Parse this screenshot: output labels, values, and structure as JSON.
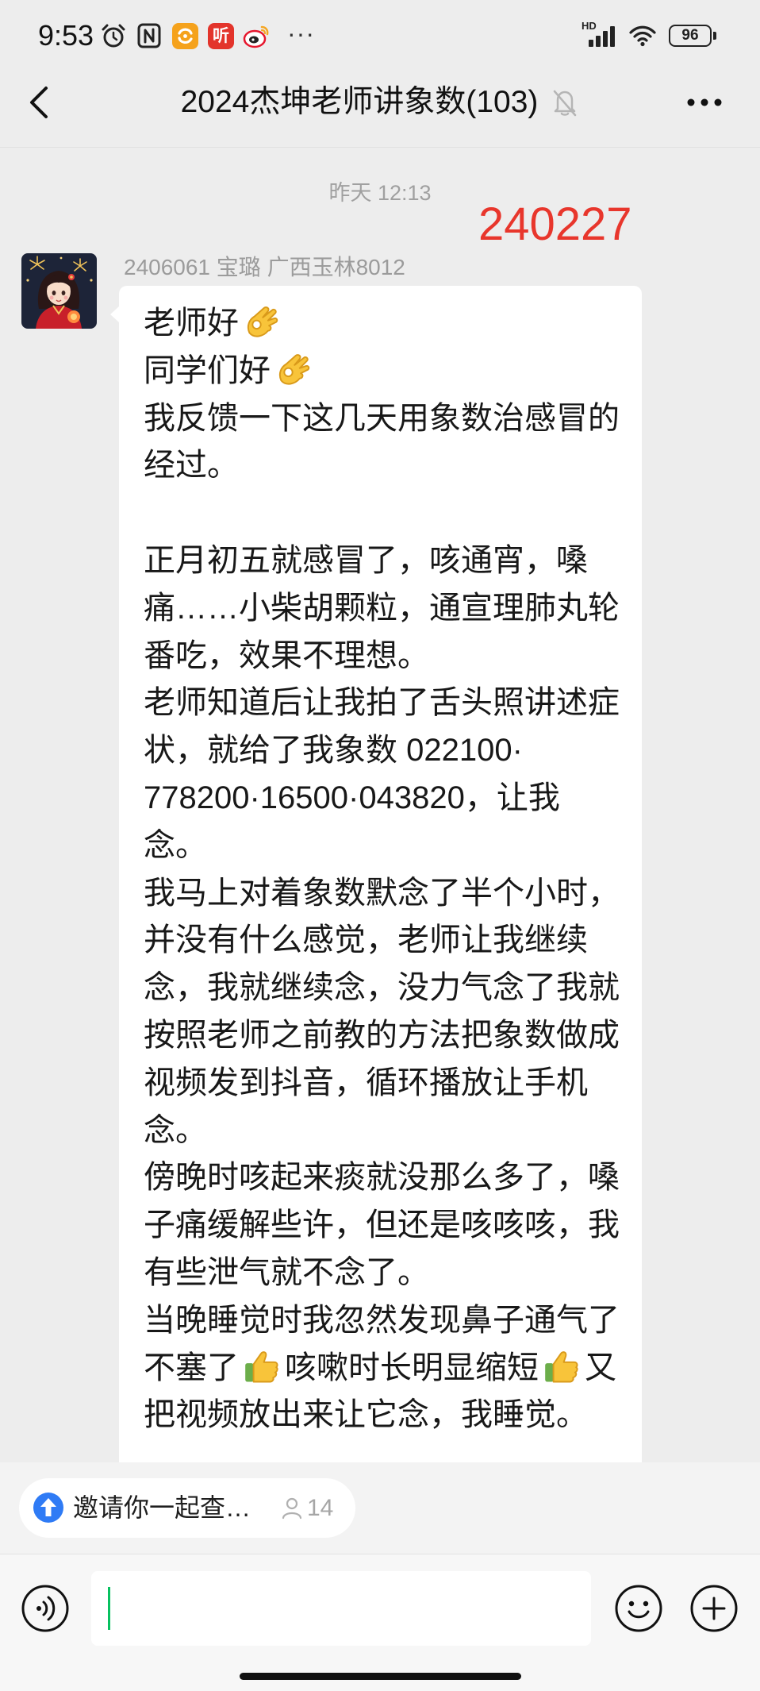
{
  "status_bar": {
    "time": "9:53",
    "notification_icons": [
      "alarm-icon",
      "nfc-icon",
      "orange-app-icon",
      "ting-app-icon",
      "weibo-icon"
    ],
    "ting_app_label": "听",
    "more_notifications": "···",
    "network_label": "HD",
    "signal_icon": "signal-bars-icon",
    "wifi_icon": "wifi-icon",
    "battery_level": "96"
  },
  "header": {
    "back_icon": "chevron-left-icon",
    "title": "2024杰坤老师讲象数(103)",
    "mute_icon": "bell-off-icon",
    "more_icon": "more-dots-icon"
  },
  "chat": {
    "timestamp": "昨天 12:13",
    "annotation": "240227",
    "message": {
      "sender": "2406061 宝璐 广西玉林8012",
      "avatar_icon": "avatar-girl-fireworks",
      "lines": [
        "老师好👌",
        "同学们好👌",
        "我反馈一下这几天用象数治感冒的",
        "经过。",
        "",
        "正月初五就感冒了，咳通宵，嗓",
        "痛……小柴胡颗粒，通宣理肺丸轮",
        "番吃，效果不理想。",
        "老师知道后让我拍了舌头照讲述症",
        "状，就给了我象数 022100·",
        "778200·16500·043820，让我",
        "念。",
        "我马上对着象数默念了半个小时，",
        "并没有什么感觉，老师让我继续",
        "念，我就继续念，没力气念了我就",
        "按照老师之前教的方法把象数做成",
        "视频发到抖音，循环播放让手机",
        "念。",
        "傍晚时咳起来痰就没那么多了，嗓",
        "子痛缓解些许，但还是咳咳咳，我",
        "有些泄气就不念了。",
        "当晚睡觉时我忽然发现鼻子通气了",
        "不塞了👍咳嗽时长明显缩短👍又",
        "把视频放出来让它念，我睡觉。"
      ]
    }
  },
  "invite_pill": {
    "icon": "blue-arrow-circle-icon",
    "text": "邀请你一起查…",
    "members_icon": "person-icon",
    "count": "14"
  },
  "input_bar": {
    "voice_icon": "voice-icon",
    "text": "",
    "emoji_icon": "smiley-icon",
    "plus_icon": "plus-circle-icon"
  },
  "colors": {
    "chat_background": "#ededed",
    "bubble": "#ffffff",
    "annotation": "#e8362c",
    "cursor": "#07c160",
    "accent_blue": "#2f7bf5"
  }
}
